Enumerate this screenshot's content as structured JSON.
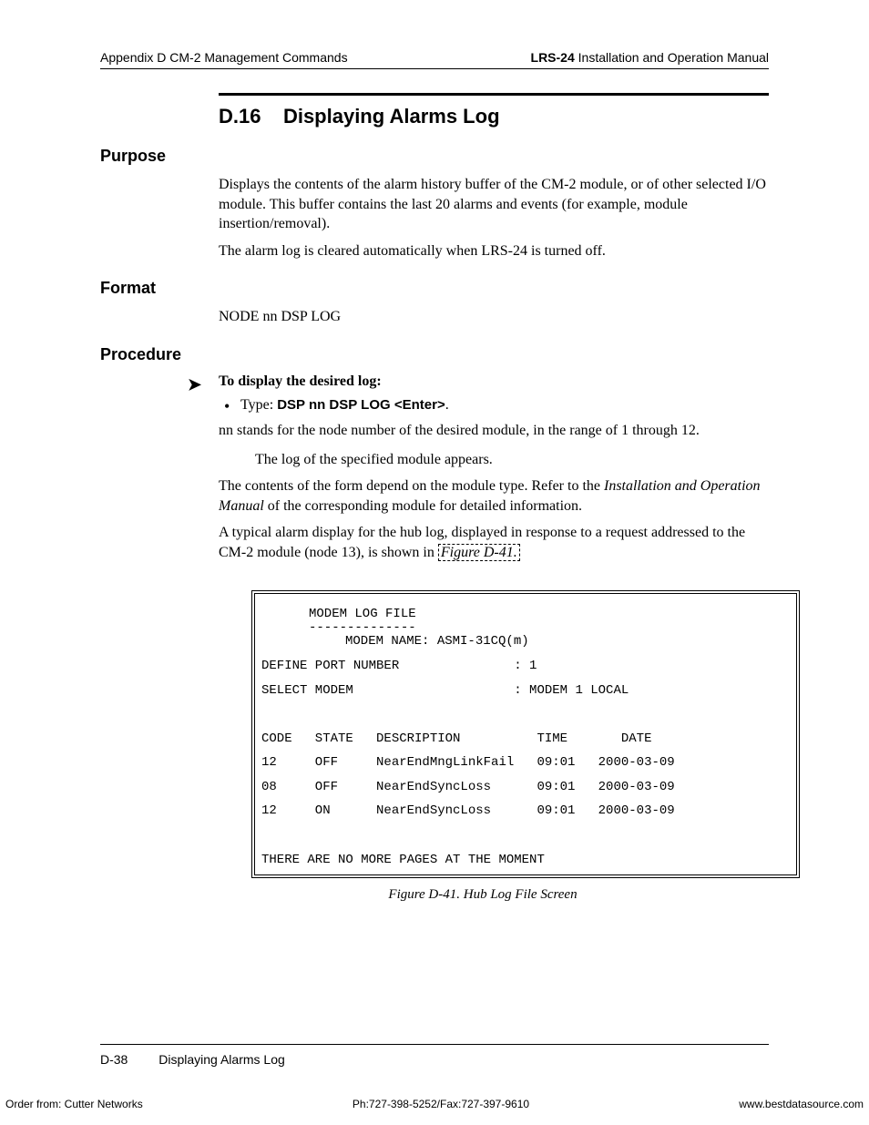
{
  "header": {
    "left": "Appendix D  CM-2 Management Commands",
    "right_bold": "LRS-24",
    "right_rest": " Installation and Operation Manual"
  },
  "section": {
    "number": "D.16",
    "title": "Displaying Alarms Log"
  },
  "purpose": {
    "heading": "Purpose",
    "p1": "Displays the contents of the alarm history buffer of the CM-2 module, or of other selected I/O module. This buffer contains the last 20 alarms and events (for example, module insertion/removal).",
    "p2": "The alarm log is cleared automatically when LRS-24 is turned off."
  },
  "format": {
    "heading": "Format",
    "text": "NODE nn DSP LOG"
  },
  "procedure": {
    "heading": "Procedure",
    "lead": "To display the desired log:",
    "bullet_prefix": "Type: ",
    "bullet_cmd": "DSP nn DSP LOG <Enter>",
    "bullet_suffix": ".",
    "p_nn": "nn stands for the node number of the desired module, in the range of 1 through 12.",
    "p_log_appears": "The log of the specified module appears.",
    "p_contents_a": "The contents of the form depend on the module type. Refer to the ",
    "p_contents_italic": "Installation and Operation Manual",
    "p_contents_b": " of the corresponding module for detailed information.",
    "p_typical_a": "A typical alarm display for the hub log, displayed in response to a request addressed to the CM-2 module (node 13), is shown in ",
    "fig_ref": "Figure D-41.",
    "p_typical_b": ""
  },
  "terminal": {
    "title": "MODEM LOG FILE",
    "dashes": "--------------",
    "modem_name_line": "MODEM NAME: ASMI-31CQ(m)",
    "define_port": "DEFINE PORT NUMBER               : 1",
    "select_modem": "SELECT MODEM                     : MODEM 1 LOCAL",
    "header_row": "CODE   STATE   DESCRIPTION          TIME       DATE",
    "rows": [
      "12     OFF     NearEndMngLinkFail   09:01   2000-03-09",
      "08     OFF     NearEndSyncLoss      09:01   2000-03-09",
      "12     ON      NearEndSyncLoss      09:01   2000-03-09"
    ],
    "footer_line": "THERE ARE NO MORE PAGES AT THE MOMENT"
  },
  "figure_caption": "Figure D-41.  Hub Log File Screen",
  "footer": {
    "page": "D-38",
    "title": "Displaying Alarms Log"
  },
  "extreme_footer": {
    "left": "Order from: Cutter Networks",
    "center": "Ph:727-398-5252/Fax:727-397-9610",
    "right": "www.bestdatasource.com"
  }
}
